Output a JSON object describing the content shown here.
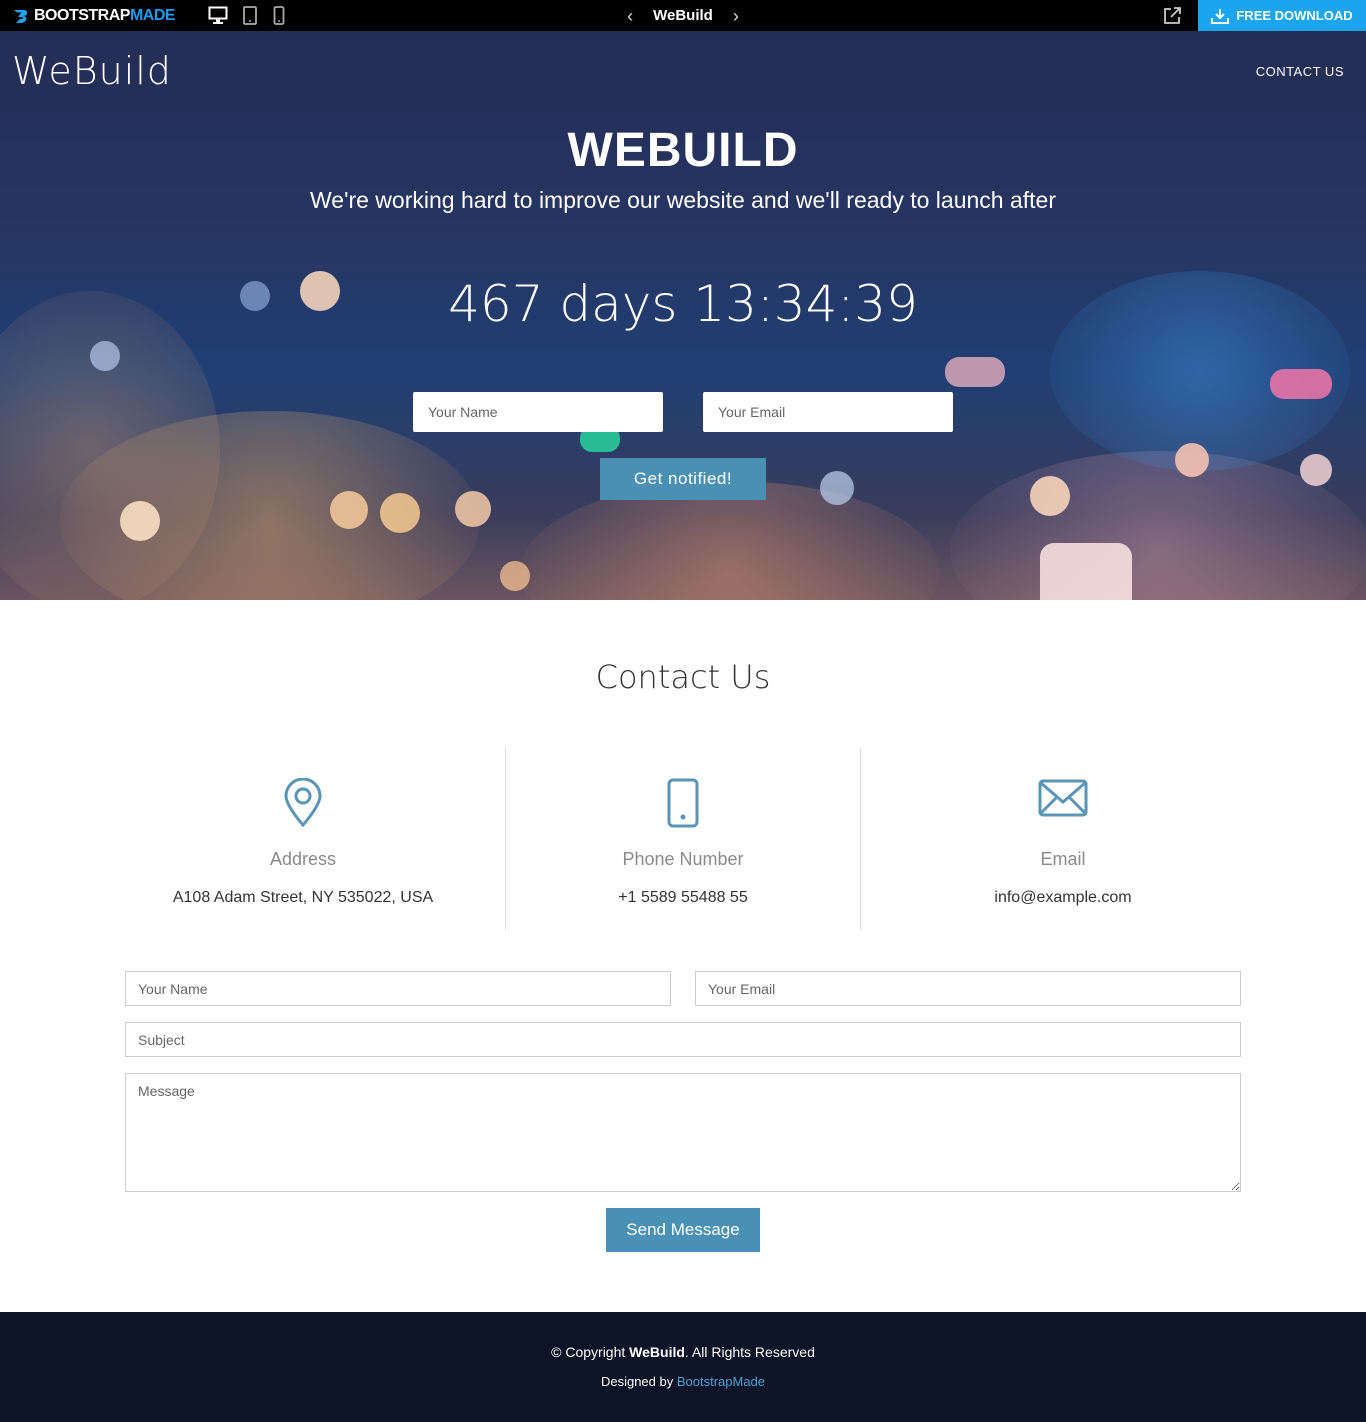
{
  "topbar": {
    "logo_part1": "BOOTSTRAP",
    "logo_part2": "MADE",
    "title": "WeBuild",
    "prev_arrow": "‹",
    "next_arrow": "›",
    "download_label": "FREE DOWNLOAD",
    "accent_color": "#1ba4f0"
  },
  "header": {
    "brand": "WeBuild",
    "nav_contact": "CONTACT US"
  },
  "hero": {
    "title": "WEBUILD",
    "subtitle": "We're working hard to improve our website and we'll ready to launch after",
    "countdown": "467 days 13:34:39",
    "name_placeholder": "Your Name",
    "email_placeholder": "Your Email",
    "notify_label": "Get notified!"
  },
  "contact": {
    "title": "Contact Us",
    "items": [
      {
        "icon": "map-pin-icon",
        "label": "Address",
        "value": "A108 Adam Street, NY 535022, USA"
      },
      {
        "icon": "phone-icon",
        "label": "Phone Number",
        "value": "+1 5589 55488 55"
      },
      {
        "icon": "envelope-icon",
        "label": "Email",
        "value": "info@example.com"
      }
    ],
    "form": {
      "name_placeholder": "Your Name",
      "email_placeholder": "Your Email",
      "subject_placeholder": "Subject",
      "message_placeholder": "Message",
      "send_label": "Send Message"
    },
    "accent_color": "#4a90b4"
  },
  "footer": {
    "copyright_prefix": "© Copyright",
    "copyright_brand": "WeBuild",
    "copyright_suffix": ". All Rights Reserved",
    "designed_prefix": "Designed by",
    "designed_link": "BootstrapMade"
  }
}
